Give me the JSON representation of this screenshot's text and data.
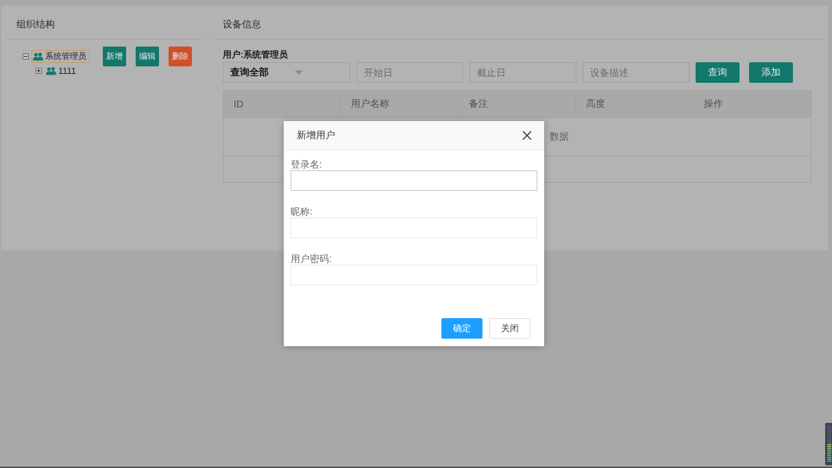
{
  "sidebar": {
    "title": "组织结构",
    "tree": [
      {
        "label": "系统管理员",
        "expanded": true,
        "selected": true,
        "children": [
          {
            "label": "1111",
            "expanded": false,
            "selected": false
          }
        ]
      }
    ],
    "buttons": [
      {
        "label": "新增",
        "kind": "primary"
      },
      {
        "label": "编辑",
        "kind": "primary"
      },
      {
        "label": "删除",
        "kind": "danger"
      }
    ]
  },
  "main": {
    "title": "设备信息",
    "user_label": "用户:系统管理员",
    "query_select": {
      "value": "查询全部"
    },
    "filters": [
      {
        "placeholder": "开始日"
      },
      {
        "placeholder": "截止日"
      },
      {
        "placeholder": "设备描述"
      }
    ],
    "buttons": [
      {
        "label": "查询"
      },
      {
        "label": "添加"
      }
    ],
    "table": {
      "columns": [
        "ID",
        "用户名称",
        "备注",
        "高度",
        "操作"
      ],
      "empty_message": "数据"
    }
  },
  "dialog": {
    "title": "新增用户",
    "fields": [
      {
        "label": "登录名:",
        "focused": true
      },
      {
        "label": "昵称:",
        "focused": false
      },
      {
        "label": "用户密码:",
        "focused": false
      }
    ],
    "buttons": [
      {
        "label": "确定",
        "kind": "primary"
      },
      {
        "label": "关闭",
        "kind": "default"
      }
    ]
  }
}
